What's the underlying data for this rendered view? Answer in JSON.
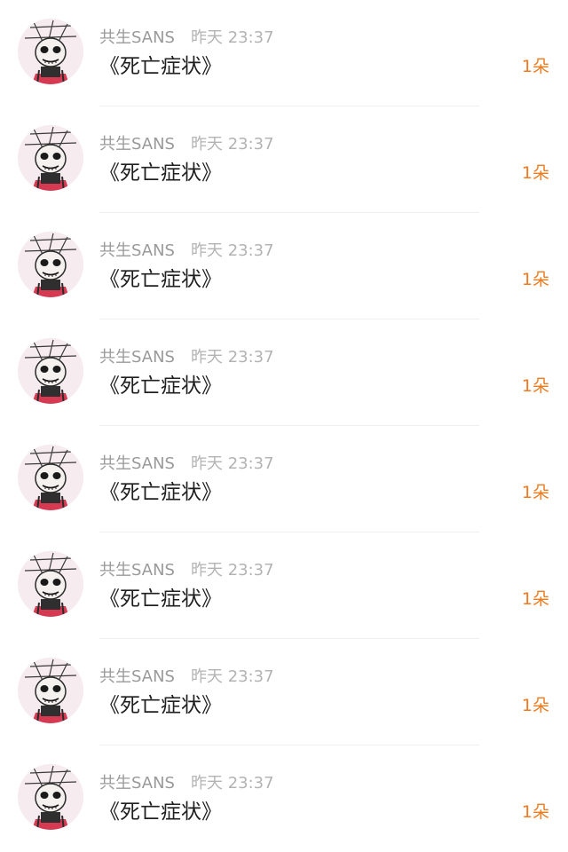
{
  "colors": {
    "author": "#9a9a9a",
    "time": "#b3b3b3",
    "content": "#1f1f1f",
    "count": "#f07a1f",
    "divider": "#efefef"
  },
  "avatar_icon": "sans-skeleton-avatar",
  "items": [
    {
      "author": "共生SANS",
      "time": "昨天 23:37",
      "content": "《死亡症状》",
      "count": "1朵"
    },
    {
      "author": "共生SANS",
      "time": "昨天 23:37",
      "content": "《死亡症状》",
      "count": "1朵"
    },
    {
      "author": "共生SANS",
      "time": "昨天 23:37",
      "content": "《死亡症状》",
      "count": "1朵"
    },
    {
      "author": "共生SANS",
      "time": "昨天 23:37",
      "content": "《死亡症状》",
      "count": "1朵"
    },
    {
      "author": "共生SANS",
      "time": "昨天 23:37",
      "content": "《死亡症状》",
      "count": "1朵"
    },
    {
      "author": "共生SANS",
      "time": "昨天 23:37",
      "content": "《死亡症状》",
      "count": "1朵"
    },
    {
      "author": "共生SANS",
      "time": "昨天 23:37",
      "content": "《死亡症状》",
      "count": "1朵"
    },
    {
      "author": "共生SANS",
      "time": "昨天 23:37",
      "content": "《死亡症状》",
      "count": "1朵"
    }
  ]
}
